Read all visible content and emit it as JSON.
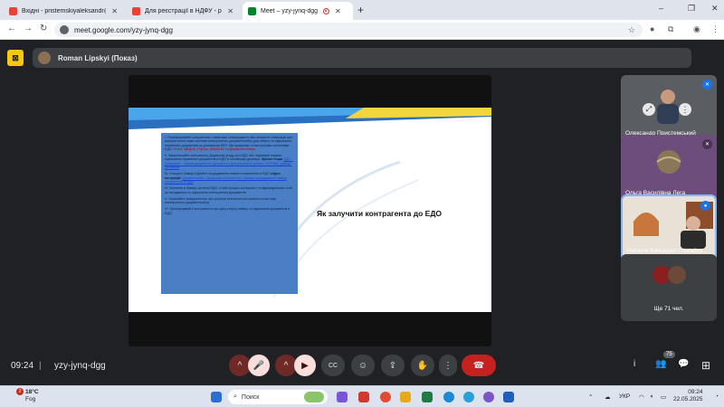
{
  "browser": {
    "tabs": [
      {
        "title": "Вхідні - pristemskiyaleksandr@",
        "active": false
      },
      {
        "title": "Для реєстрації в НДФУ - prystr",
        "active": false
      },
      {
        "title": "Meet – yzy-jynq-dgg",
        "active": true
      }
    ],
    "new_tab": "+",
    "url": "meet.google.com/yzy-jynq-dgg",
    "window_controls": {
      "minimize": "–",
      "restore": "❐",
      "close": "✕"
    }
  },
  "meet": {
    "presenter": "Roman Lipskyi (Показ)",
    "slide": {
      "title": "Як залучити контрагента до ЕДО",
      "steps": [
        {
          "text": "I. Проінформуйте контрагента з яким вже співпрацюєте або плануєте співпрацю про використання нами системи електронного документообігу для обміну та підписання первинних документів за допомогою КЕП. Ми працюємо зі наступними системами ЕДО: ",
          "highlight": "ПТАХ, МЕДОК, PlyDoc, ВЧАСНО та Документ.Online"
        },
        {
          "text": "II. Запропонуйте контрагенту Додаткову угоду про ЕДО або перевірте наявне підписання первинних документів в ЕДО в основному договорі. ",
          "bold": "Зразок Угоди",
          "link": "ЕДО – Довідники – Зразки документів (Документи для договірної роботи / ЮРИДИ_Довідн. Договорів"
        },
        {
          "text": "III. Створіть Заявку в ДімКит на додавання нового контрагента в ЕДО ",
          "bold": "згідно Інструкції:",
          "link": "Документообіг / Довідники контрагента / Заявки на додавання нового контрагента в ЕДО"
        },
        {
          "text": "IV. Зазначте в Заявці систему ЕДО, в якій працює контрагент та відповідальних осіб за погодження та підписання електронних документів."
        },
        {
          "text": "V. Отримайте повідомлення про успішне внесення контрагента в систему електронного документообігу."
        },
        {
          "text": "VI. Проінформуйте контрагента про дату старту обміну та підписання документів в ЕДО."
        }
      ]
    },
    "participants": [
      {
        "name": "Олександр Пристемський",
        "mic": "muted-active"
      },
      {
        "name": "Ольга Василівна Лега",
        "mic": "muted"
      },
      {
        "name": "Наталія Канцедал / Nataliya...",
        "mic": "speaking"
      },
      {
        "name": "Ще 71 чел.",
        "mic": ""
      }
    ],
    "clock": "09:24",
    "separator": "|",
    "meeting_code": "yzy-jynq-dgg",
    "participant_count": "75",
    "controls": {
      "chevron_mic": "^",
      "mic": "🎤",
      "chevron_cam": "^",
      "cam": "▶",
      "captions": "CC",
      "emoji": "☺",
      "present": "⇪",
      "hand": "✋",
      "more": "⋮",
      "leave": "☎",
      "info": "i",
      "people": "👥",
      "chat": "💬",
      "activities": "⊞"
    }
  },
  "taskbar": {
    "weather_temp": "18°C",
    "weather_desc": "Fog",
    "weather_badge": "2",
    "search_placeholder": "Поиск",
    "language": "УКР",
    "time": "09:24",
    "date": "22.05.2025"
  }
}
